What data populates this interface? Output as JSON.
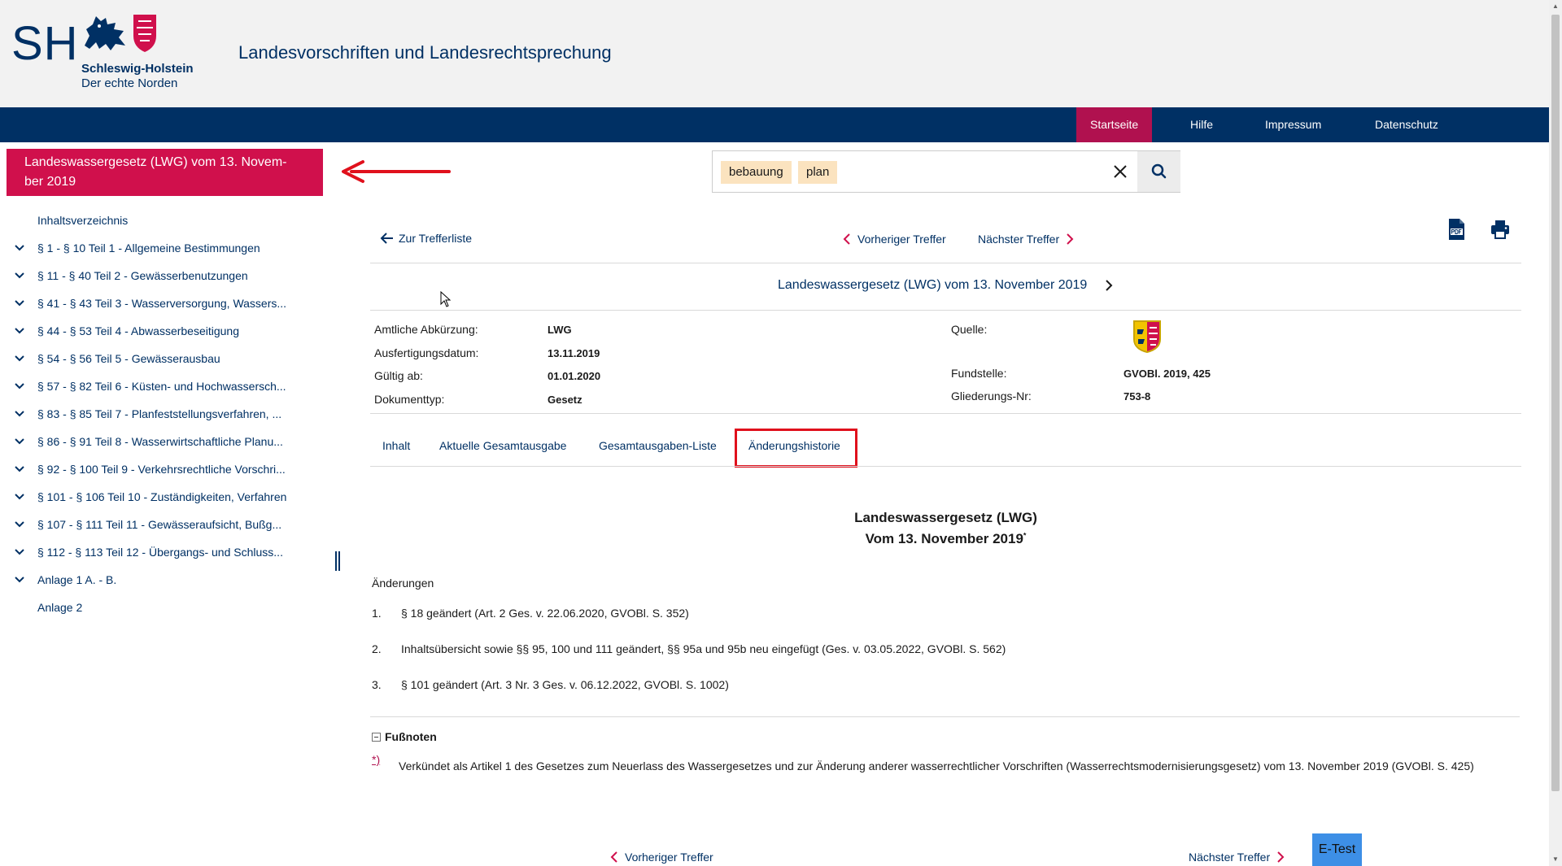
{
  "header": {
    "logo_abbr": "SH",
    "logo_line1": "Schleswig-Holstein",
    "logo_line2": "Der echte Norden",
    "site_title": "Landesvorschriften und Landesrechtsprechung"
  },
  "nav": {
    "items": [
      {
        "label": "Startseite",
        "active": true
      },
      {
        "label": "Hilfe",
        "active": false
      },
      {
        "label": "Impressum",
        "active": false
      },
      {
        "label": "Datenschutz",
        "active": false
      }
    ]
  },
  "sidebar": {
    "title_line1": "Landeswassergesetz (LWG) vom 13. Novem-",
    "title_line2": "ber 2019",
    "toc": [
      {
        "label": "Inhaltsverzeichnis",
        "expandable": false
      },
      {
        "label": "§ 1 - § 10 Teil 1 - Allgemeine Bestimmungen",
        "expandable": true
      },
      {
        "label": "§ 11 - § 40 Teil 2 - Gewässerbenutzungen",
        "expandable": true
      },
      {
        "label": "§ 41 - § 43 Teil 3 - Wasserversorgung, Wassers...",
        "expandable": true
      },
      {
        "label": "§ 44 - § 53 Teil 4 - Abwasserbeseitigung",
        "expandable": true
      },
      {
        "label": "§ 54 - § 56 Teil 5 - Gewässerausbau",
        "expandable": true
      },
      {
        "label": "§ 57 - § 82 Teil 6 - Küsten- und Hochwassersch...",
        "expandable": true
      },
      {
        "label": "§ 83 - § 85 Teil 7 - Planfeststellungsverfahren, ...",
        "expandable": true
      },
      {
        "label": "§ 86 - § 91 Teil 8 - Wasserwirtschaftliche Planu...",
        "expandable": true
      },
      {
        "label": "§ 92 - § 100 Teil 9 - Verkehrsrechtliche Vorschri...",
        "expandable": true
      },
      {
        "label": "§ 101 - § 106 Teil 10 - Zuständigkeiten, Verfahren",
        "expandable": true
      },
      {
        "label": "§ 107 - § 111 Teil 11 - Gewässeraufsicht, Bußg...",
        "expandable": true
      },
      {
        "label": "§ 112 - § 113 Teil 12 - Übergangs- und Schluss...",
        "expandable": true
      },
      {
        "label": "Anlage 1 A. - B.",
        "expandable": true
      },
      {
        "label": "Anlage 2",
        "expandable": false
      }
    ]
  },
  "search": {
    "chips": [
      "bebauung",
      "plan"
    ]
  },
  "toolbar": {
    "back_label": "Zur Trefferliste",
    "prev_label": "Vorheriger Treffer",
    "next_label": "Nächster Treffer"
  },
  "document": {
    "title_link": "Landeswassergesetz (LWG) vom 13. November 2019",
    "meta": {
      "abkuerzung_label": "Amtliche Abkürzung:",
      "abkuerzung_value": "LWG",
      "ausfertigung_label": "Ausfertigungsdatum:",
      "ausfertigung_value": "13.11.2019",
      "gueltig_label": "Gültig ab:",
      "gueltig_value": "01.01.2020",
      "doktyp_label": "Dokumenttyp:",
      "doktyp_value": "Gesetz",
      "quelle_label": "Quelle:",
      "fundstelle_label": "Fundstelle:",
      "fundstelle_value": "GVOBl. 2019, 425",
      "gliederung_label": "Gliederungs-Nr:",
      "gliederung_value": "753-8"
    },
    "tabs": [
      {
        "label": "Inhalt",
        "active": false
      },
      {
        "label": "Aktuelle Gesamtausgabe",
        "active": false
      },
      {
        "label": "Gesamtausgaben-Liste",
        "active": false
      },
      {
        "label": "Änderungshistorie",
        "active": true
      }
    ],
    "law_title_line1": "Landeswassergesetz (LWG)",
    "law_title_line2": "Vom 13. November 2019",
    "law_title_sup": "*",
    "changes_heading": "Änderungen",
    "changes": [
      {
        "num": "1.",
        "text": "§ 18 geändert (Art. 2 Ges. v. 22.06.2020, GVOBl. S. 352)"
      },
      {
        "num": "2.",
        "text": "Inhaltsübersicht sowie §§ 95, 100 und 111 geändert, §§ 95a und 95b neu eingefügt (Ges. v. 03.05.2022, GVOBl. S. 562)"
      },
      {
        "num": "3.",
        "text": "§ 101 geändert (Art. 3 Nr. 3 Ges. v. 06.12.2022, GVOBl. S. 1002)"
      }
    ],
    "footnotes_heading": "Fußnoten",
    "footnote_mark": "*)",
    "footnote_text": "Verkündet als Artikel 1 des Gesetzes zum Neuerlass des Wassergesetzes und zur Änderung anderer wasserrechtlicher Vorschriften (Wasserrechtsmodernisierungsgesetz) vom 13. November 2019 (GVOBl. S. 425)"
  },
  "bottom": {
    "prev_label": "Vorheriger Treffer",
    "next_label": "Nächster Treffer",
    "etest_label": "E-Test"
  },
  "colors": {
    "brand_blue": "#003064",
    "brand_red": "#d0104c",
    "nav_active": "#b0114f",
    "highlight_chip": "#fbe3bf",
    "annotation_red": "#e0101c"
  }
}
